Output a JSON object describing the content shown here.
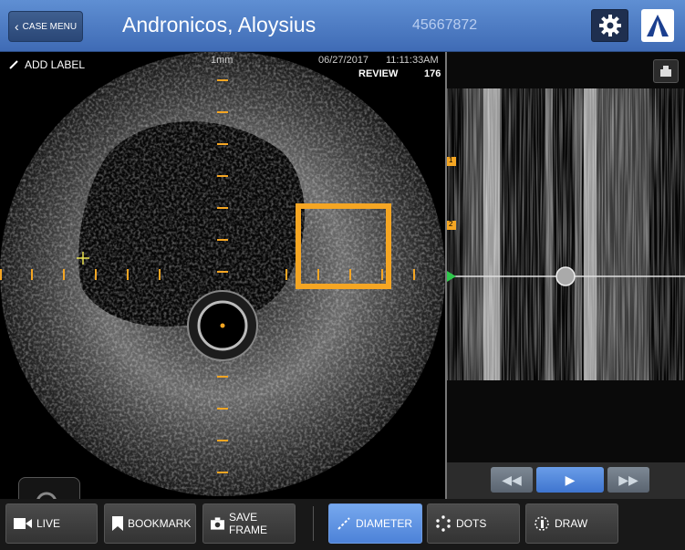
{
  "header": {
    "case_menu_label": "CASE MENU",
    "patient_name": "Andronicos, Aloysius",
    "patient_id": "45667872",
    "gear_icon": "gear-icon",
    "logo_icon": "brand-logo"
  },
  "image": {
    "add_label": "ADD LABEL",
    "scale": "1mm",
    "date": "06/27/2017",
    "time": "11:11:33AM",
    "mode": "REVIEW",
    "frame": "176",
    "accent_color": "#f5a623"
  },
  "longitudinal": {
    "bookmarks": [
      "1",
      "2"
    ],
    "playback": {
      "rewind": "◀◀",
      "play": "▶",
      "fast_forward": "▶▶"
    }
  },
  "toolbar": {
    "live": "LIVE",
    "bookmark": "BOOKMARK",
    "save_frame": "SAVE FRAME",
    "diameter": "DIAMETER",
    "dots": "DOTS",
    "draw": "DRAW"
  }
}
